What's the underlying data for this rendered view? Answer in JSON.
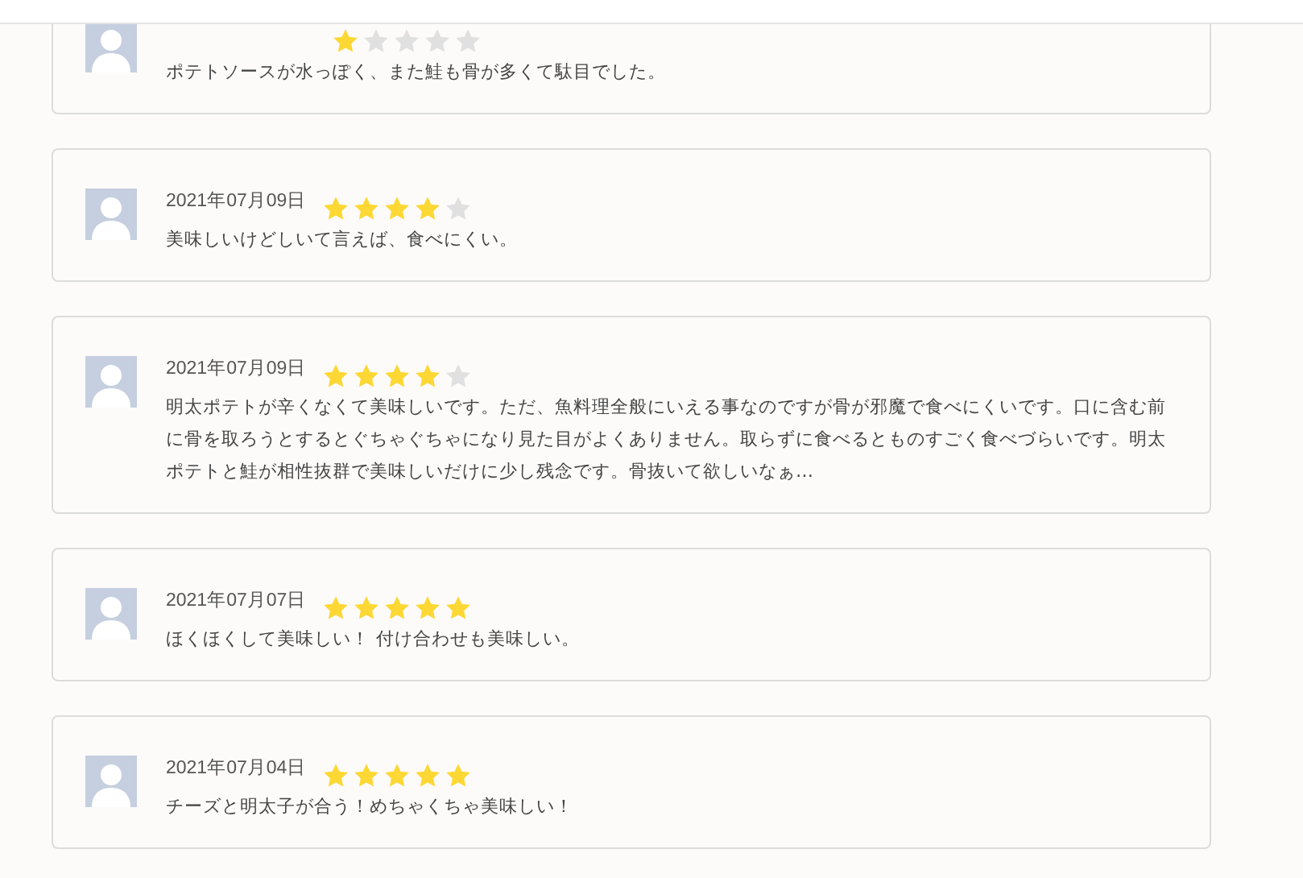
{
  "reviews": [
    {
      "stars": 1,
      "text": "ポテトソースが水っぽく、また鮭も骨が多くて駄目でした。"
    },
    {
      "date": "2021年07月09日",
      "stars": 4,
      "text": "美味しいけどしいて言えば、食べにくい。"
    },
    {
      "date": "2021年07月09日",
      "stars": 4,
      "text": "明太ポテトが辛くなくて美味しいです。ただ、魚料理全般にいえる事なのですが骨が邪魔で食べにくいです。口に含む前に骨を取ろうとするとぐちゃぐちゃになり見た目がよくありません。取らずに食べるとものすごく食べづらいです。明太ポテトと鮭が相性抜群で美味しいだけに少し残念です。骨抜いて欲しいなぁ…"
    },
    {
      "date": "2021年07月07日",
      "stars": 5,
      "text": "ほくほくして美味しい！ 付け合わせも美味しい。"
    },
    {
      "date": "2021年07月04日",
      "stars": 5,
      "text": "チーズと明太子が合う！めちゃくちゃ美味しい！"
    }
  ]
}
